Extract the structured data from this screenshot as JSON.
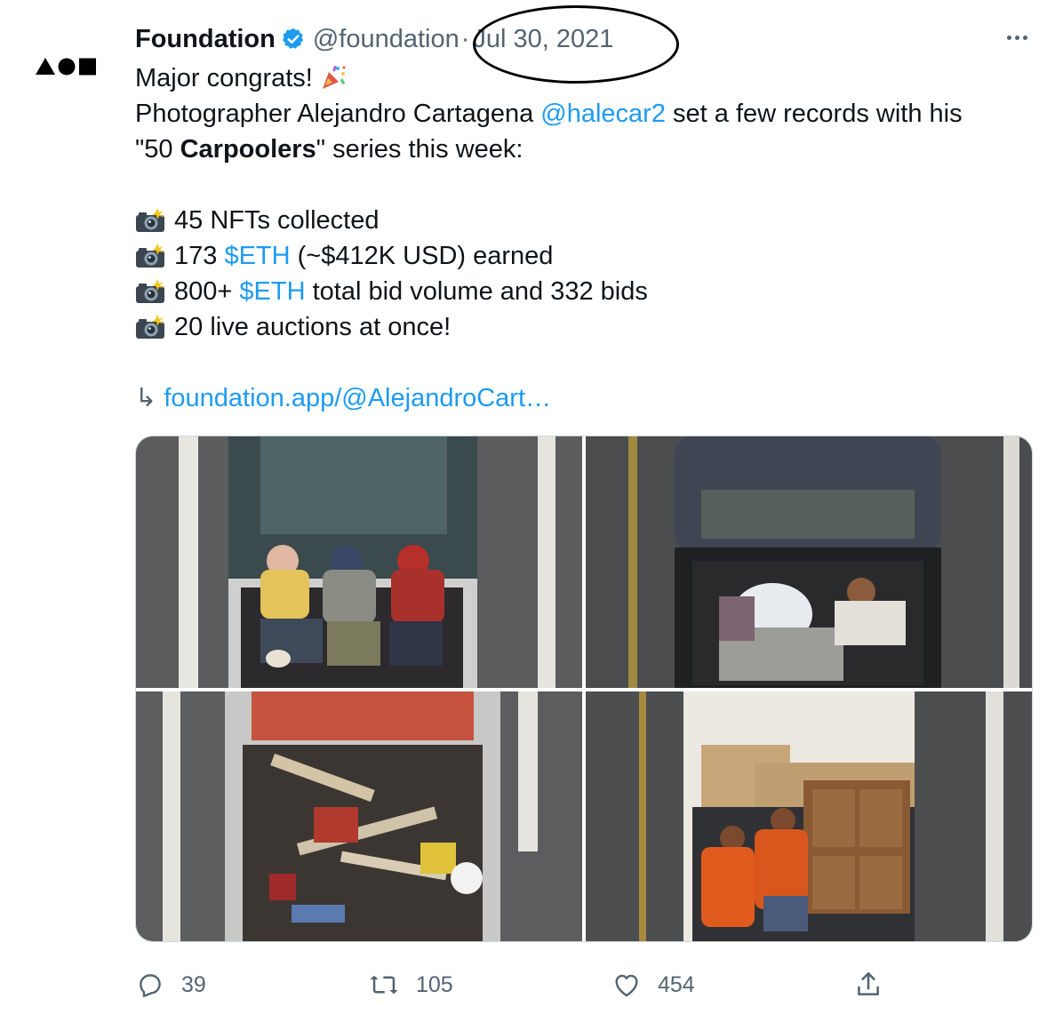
{
  "account": {
    "name": "Foundation",
    "handle": "@foundation",
    "separator": "·",
    "date": "Jul 30, 2021",
    "avatar_icon": "foundation-logo-icon",
    "verified_icon": "verified-badge-icon",
    "verified_color": "#1d9bf0"
  },
  "tweet": {
    "line1": "Major congrats!",
    "line2_prefix": "Photographer Alejandro Cartagena ",
    "line2_mention": "@halecar2",
    "line2_suffix": " set a few records with his",
    "line3_prefix": "\"50 ",
    "line3_bold": "Carpoolers",
    "line3_suffix": "\" series this week:",
    "stats": [
      {
        "prefix": "45 NFTs collected",
        "cashtag": "",
        "suffix": ""
      },
      {
        "prefix": "173 ",
        "cashtag": "$ETH",
        "suffix": " (~$412K USD) earned"
      },
      {
        "prefix": "800+ ",
        "cashtag": "$ETH",
        "suffix": " total bid volume and 332 bids"
      },
      {
        "prefix": "20 live auctions at once!",
        "cashtag": "",
        "suffix": ""
      }
    ],
    "link_arrow": "↳",
    "link": "foundation.app/@AlejandroCart…",
    "link_color": "#1d9bf0"
  },
  "actions": {
    "replies": "39",
    "retweets": "105",
    "likes": "454",
    "reply_icon": "reply-icon",
    "retweet_icon": "retweet-icon",
    "like_icon": "heart-icon",
    "share_icon": "share-icon"
  }
}
